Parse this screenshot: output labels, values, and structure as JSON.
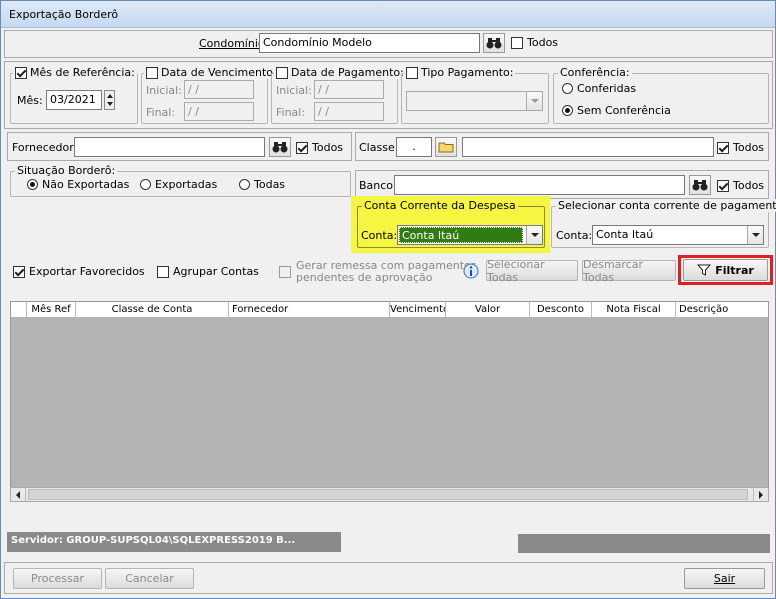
{
  "window": {
    "title": "Exportação Borderô"
  },
  "condominio": {
    "label": "Condomínio:",
    "value": "Condomínio Modelo",
    "todos_label": "Todos",
    "todos_checked": false
  },
  "mes_referencia": {
    "label": "Mês de Referência:",
    "checked": true,
    "mes_label": "Mês:",
    "mes_value": "03/2021"
  },
  "data_vencimento": {
    "label": "Data de Vencimento:",
    "checked": false,
    "inicial_label": "Inicial:",
    "final_label": "Final:",
    "inicial_value": " /  /",
    "final_value": " /  /"
  },
  "data_pagamento": {
    "label": "Data de Pagamento:",
    "checked": false,
    "inicial_label": "Inicial:",
    "final_label": "Final:",
    "inicial_value": " /  /",
    "final_value": " /  /"
  },
  "tipo_pagamento": {
    "label": "Tipo Pagamento:",
    "checked": false,
    "value": ""
  },
  "conferencia": {
    "label": "Conferência:",
    "options": [
      "Conferidas",
      "Sem Conferência"
    ],
    "selected": "Sem Conferência"
  },
  "fornecedor": {
    "label": "Fornecedor:",
    "value": "",
    "todos_label": "Todos",
    "todos_checked": true
  },
  "classe": {
    "label": "Classe:",
    "code_value": ".",
    "name_value": "",
    "todos_label": "Todos",
    "todos_checked": true
  },
  "situacao": {
    "label": "Situação Borderô:",
    "options": [
      "Não Exportadas",
      "Exportadas",
      "Todas"
    ],
    "selected": "Não Exportadas"
  },
  "banco": {
    "label": "Banco:",
    "value": "",
    "todos_label": "Todos",
    "todos_checked": true
  },
  "conta_despesa": {
    "label": "Conta Corrente da Despesa",
    "conta_label": "Conta:",
    "value": "Conta Itaú",
    "highlight_color": "#f5f542",
    "selected_bg": "#2f7d12"
  },
  "conta_pagamento": {
    "label": "Selecionar conta corrente de pagamento",
    "conta_label": "Conta:",
    "value": "Conta Itaú"
  },
  "options": {
    "exportar_favorecidos_label": "Exportar Favorecidos",
    "exportar_favorecidos_checked": true,
    "agrupar_contas_label": "Agrupar Contas",
    "agrupar_contas_checked": false,
    "gerar_remessa_line1": "Gerar remessa com pagamentos",
    "gerar_remessa_line2": "pendentes de aprovação",
    "gerar_remessa_checked": false
  },
  "buttons": {
    "selecionar_todas": "Selecionar Todas",
    "desmarcar_todas": "Desmarcar Todas",
    "filtrar": "Filtrar",
    "processar": "Processar",
    "cancelar": "Cancelar",
    "sair": "Sair",
    "filtrar_highlight": "#e02020"
  },
  "grid": {
    "columns": [
      "",
      "Mês Ref",
      "Classe de Conta",
      "Fornecedor",
      "Vencimento",
      "Valor",
      "Desconto",
      "Nota Fiscal",
      "Descrição"
    ]
  },
  "status": {
    "servidor": "Servidor: GROUP-SUPSQL04\\SQLEXPRESS2019 B..."
  }
}
